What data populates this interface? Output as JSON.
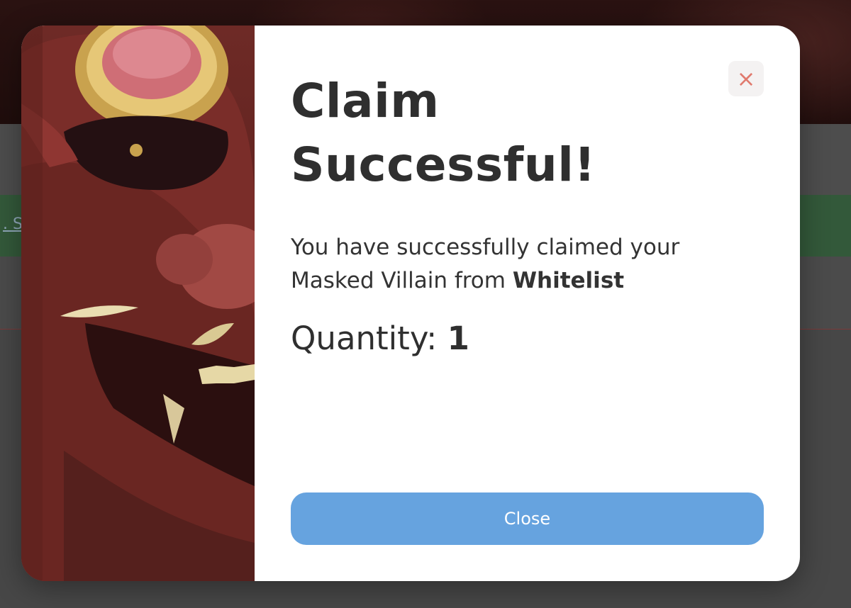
{
  "background": {
    "link_text": ". St",
    "colors": {
      "green_band": "#33593a",
      "overlay": "#4a4a4a"
    }
  },
  "modal": {
    "title": "Claim Successful!",
    "message_prefix": "You have successfully claimed your Masked Villain from ",
    "message_source": "Whitelist",
    "quantity_label": "Quantity: ",
    "quantity_value": "1",
    "close_button_label": "Close",
    "close_icon": "close-icon",
    "art_subject": "masked-villain-oni-mask-art",
    "colors": {
      "button": "#66a3df",
      "close_icon": "#e07a6e",
      "title_text": "#2f2f2f"
    }
  }
}
